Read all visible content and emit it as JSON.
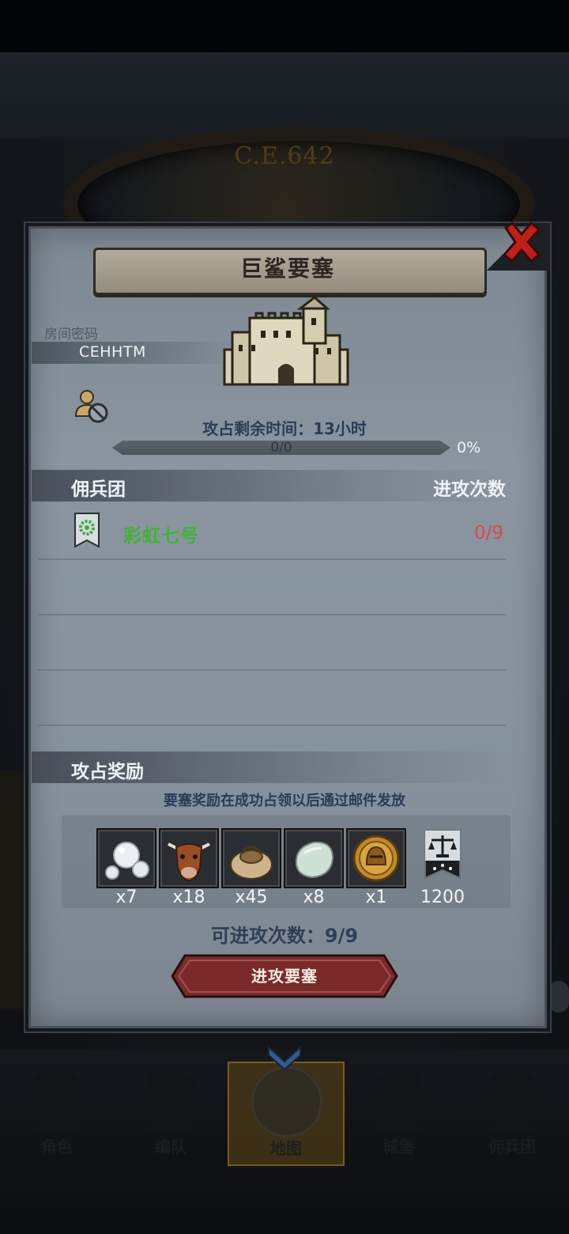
{
  "background": {
    "year_label": "C.E.642"
  },
  "bottom_nav": {
    "items": [
      {
        "label": "角色",
        "icon": "knight-icon"
      },
      {
        "label": "编队",
        "icon": "helmet-icon"
      },
      {
        "label": "地图",
        "icon": "globe-icon"
      },
      {
        "label": "城堡",
        "icon": "castle-icon"
      },
      {
        "label": "佣兵团",
        "icon": "ship-icon"
      }
    ],
    "active": "地图"
  },
  "dialog": {
    "title": "巨鲨要塞",
    "room_label": "房间密码",
    "room_code": "CEHHTM",
    "timer_text": "攻占剩余时间：13小时",
    "progress": {
      "text": "0/0",
      "percent_label": "0%",
      "fraction": 0.0
    },
    "mercenary_header": "佣兵团",
    "attacks_header": "进攻次数",
    "guilds": [
      {
        "name": "彩虹七号",
        "attacks": "0/9"
      }
    ],
    "rewards_header": "攻占奖励",
    "reward_note": "要塞奖励在成功占领以后通过邮件发放",
    "rewards": [
      {
        "icon": "pearls-icon",
        "qty": "x7"
      },
      {
        "icon": "cow-icon",
        "qty": "x18"
      },
      {
        "icon": "sack-icon",
        "qty": "x45"
      },
      {
        "icon": "stone-icon",
        "qty": "x8"
      },
      {
        "icon": "gold-helmet-coin-icon",
        "qty": "x1"
      },
      {
        "icon": "justice-badge-icon",
        "qty": "1200"
      }
    ],
    "attempts_text": "可进攻次数：9/9",
    "attack_button": "进攻要塞"
  },
  "colors": {
    "guild_name": "#3fb336",
    "attacks_value": "#d64a4a",
    "button_red": "#7a2a2a"
  }
}
